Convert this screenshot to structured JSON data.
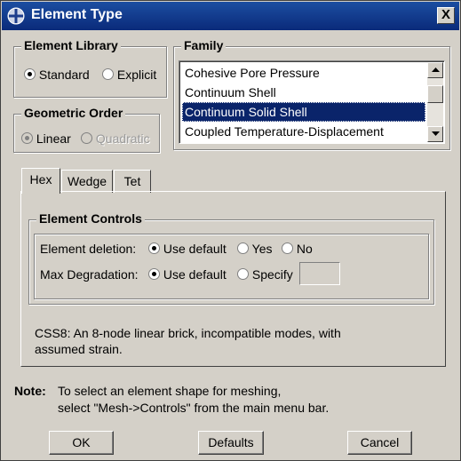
{
  "window": {
    "title": "Element Type",
    "close_label": "X"
  },
  "element_library": {
    "label": "Element Library",
    "options": [
      "Standard",
      "Explicit"
    ],
    "selected": "Standard"
  },
  "geometric_order": {
    "label": "Geometric Order",
    "options": [
      "Linear",
      "Quadratic"
    ],
    "selected": "Linear",
    "disabled_option": "Quadratic"
  },
  "family": {
    "label": "Family",
    "items": [
      "Cohesive Pore Pressure",
      "Continuum Shell",
      "Continuum Solid Shell",
      "Coupled Temperature-Displacement"
    ],
    "selected": "Continuum Solid Shell"
  },
  "tabs": {
    "items": [
      "Hex",
      "Wedge",
      "Tet"
    ],
    "active": "Hex"
  },
  "element_controls": {
    "label": "Element Controls",
    "element_deletion": {
      "label": "Element deletion:",
      "options": [
        "Use default",
        "Yes",
        "No"
      ],
      "selected": "Use default"
    },
    "max_degradation": {
      "label": "Max Degradation:",
      "options": [
        "Use default",
        "Specify"
      ],
      "selected": "Use default",
      "value": ""
    }
  },
  "description": {
    "line1": "CSS8:  An 8-node linear brick, incompatible modes, with",
    "line2": "assumed strain."
  },
  "note": {
    "label": "Note:",
    "line1": "To select an element shape for meshing,",
    "line2": "select \"Mesh->Controls\" from the main menu bar."
  },
  "buttons": {
    "ok": "OK",
    "defaults": "Defaults",
    "cancel": "Cancel"
  },
  "colors": {
    "titlebar": "#0a2a7a",
    "selection": "#0a246a",
    "dialog": "#d4d0c8"
  }
}
